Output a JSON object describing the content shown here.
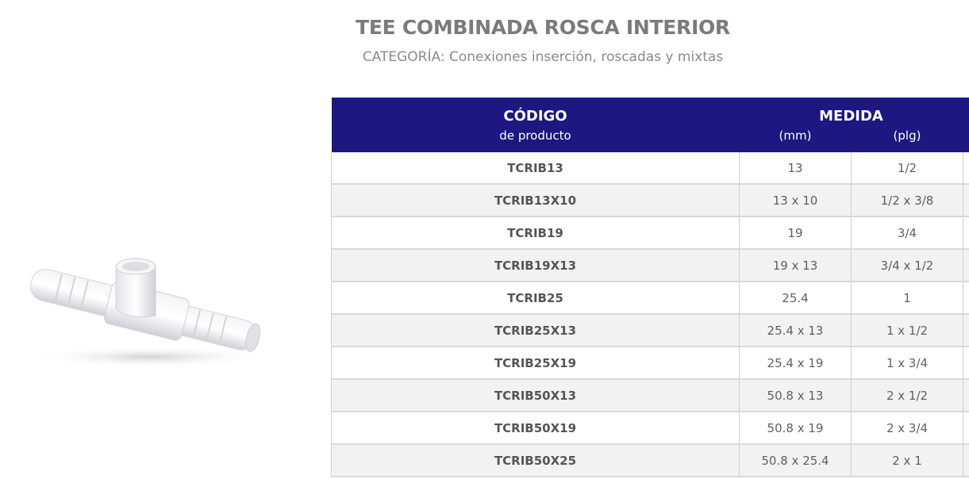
{
  "header": {
    "title": "TEE COMBINADA ROSCA INTERIOR",
    "category": "CATEGORÍA: Conexiones inserción, roscadas y mixtas"
  },
  "table": {
    "col_code_title": "CÓDIGO",
    "col_code_sub": "de producto",
    "col_measure_title": "MEDIDA",
    "col_mm": "(mm)",
    "col_plg": "(plg)",
    "header_color": "#1c1781",
    "rows": [
      {
        "code": "TCRIB13",
        "mm": "13",
        "plg": "1/2"
      },
      {
        "code": "TCRIB13X10",
        "mm": "13 x 10",
        "plg": "1/2 x 3/8"
      },
      {
        "code": "TCRIB19",
        "mm": "19",
        "plg": "3/4"
      },
      {
        "code": "TCRIB19X13",
        "mm": "19 x 13",
        "plg": "3/4 x 1/2"
      },
      {
        "code": "TCRIB25",
        "mm": "25.4",
        "plg": "1"
      },
      {
        "code": "TCRIB25X13",
        "mm": "25.4 x 13",
        "plg": "1 x 1/2"
      },
      {
        "code": "TCRIB25X19",
        "mm": "25.4 x 19",
        "plg": "1 x 3/4"
      },
      {
        "code": "TCRIB50X13",
        "mm": "50.8 x 13",
        "plg": "2 x 1/2"
      },
      {
        "code": "TCRIB50X19",
        "mm": "50.8 x 19",
        "plg": "2 x 3/4"
      },
      {
        "code": "TCRIB50X25",
        "mm": "50.8 x 25.4",
        "plg": "2 x 1"
      }
    ]
  }
}
